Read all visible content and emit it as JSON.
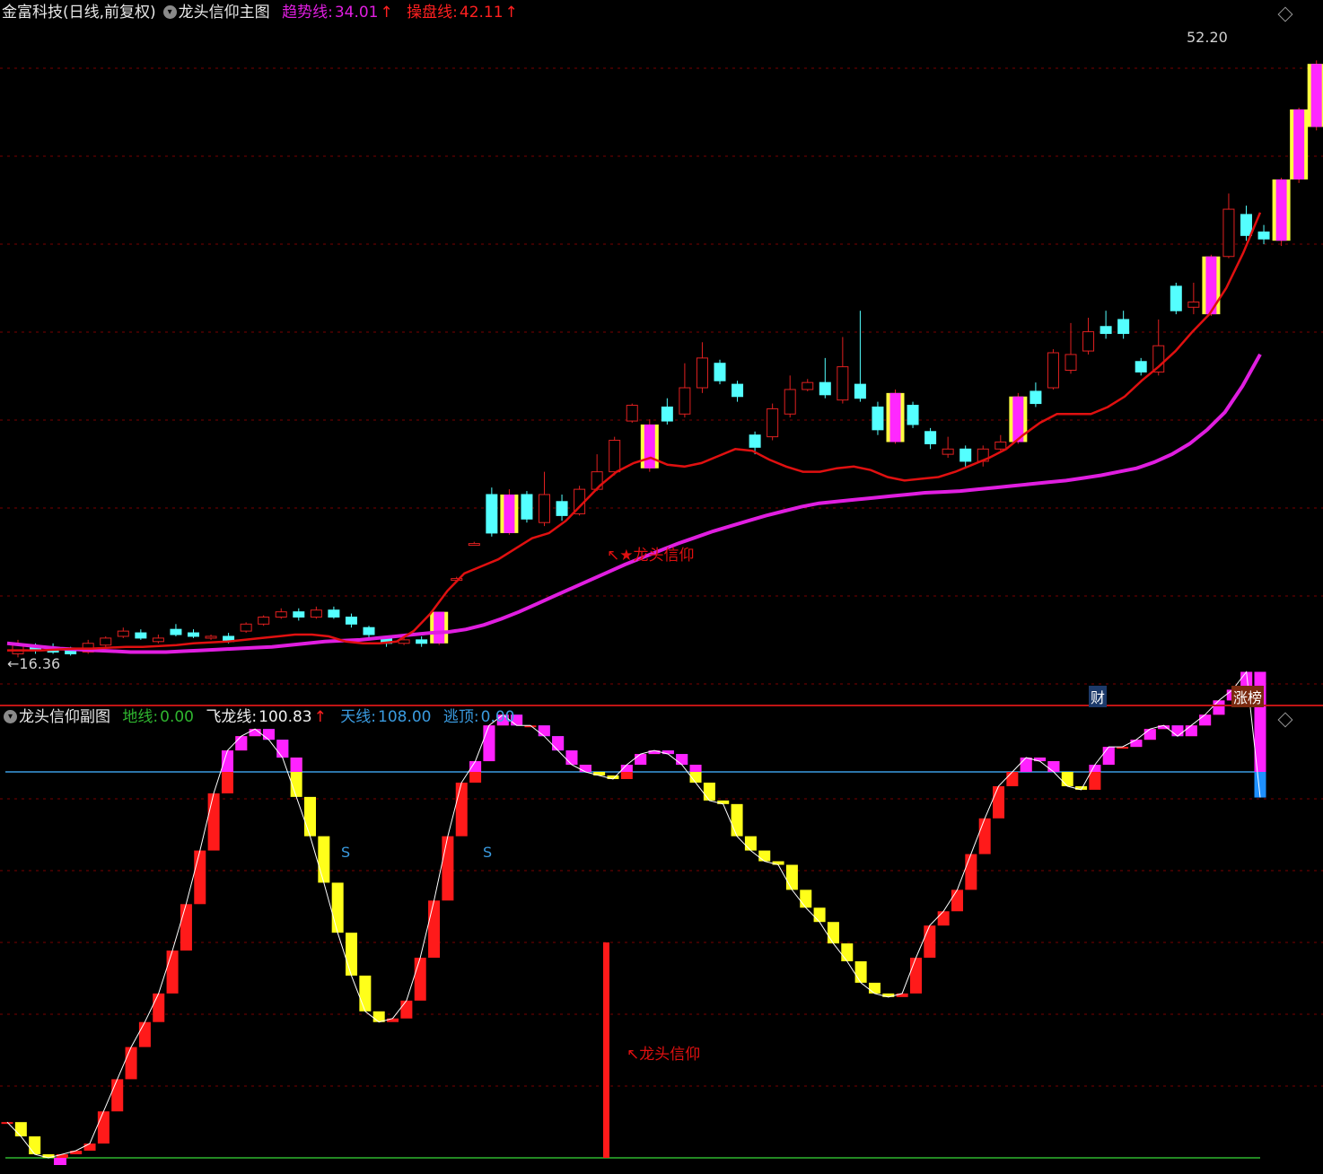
{
  "header": {
    "stock_name": "金富科技(日线,前复权)",
    "main_indicator": "龙头信仰主图",
    "trend_label": "趋势线:",
    "trend_value": "34.01",
    "operate_label": "操盘线:",
    "operate_value": "42.11",
    "up_arrow": "↑"
  },
  "sub_header": {
    "sub_indicator": "龙头信仰副图",
    "ground_label": "地线:",
    "ground_value": "0.00",
    "flydragon_label": "飞龙线:",
    "flydragon_value": "100.83",
    "sky_label": "天线:",
    "sky_value": "108.00",
    "escape_label": "逃顶:",
    "escape_value": "0.00",
    "up_arrow": "↑"
  },
  "annotations": {
    "high_price": "52.20",
    "low_price": "16.36",
    "main_signal": "↖★龙头信仰",
    "sub_signal": "↖龙头信仰",
    "sell_marker": "S",
    "finance_tag": "财",
    "limit_up_tag": "涨榜"
  },
  "colors": {
    "background": "#000000",
    "grid": "#7a0000",
    "trend_line": "#e01ee0",
    "operate_line": "#e01010",
    "up_candle": "#e02020",
    "down_candle": "#54ffff",
    "limit_up_fill": "#ff28ff",
    "limit_up_edge": "#ffff40",
    "bar_red": "#ff1a1a",
    "bar_yellow": "#ffff1a",
    "bar_blue": "#1e90ff",
    "bar_magenta": "#ff22ff",
    "sky_line": "#3a9be0",
    "ground_line": "#2fb52f"
  },
  "chart_data": [
    {
      "type": "candlestick",
      "title": "龙头信仰主图",
      "ylim": [
        15.5,
        53.5
      ],
      "series": [
        {
          "name": "趋势线",
          "values": [
            17.5,
            17.4,
            17.3,
            17.2,
            17.15,
            17.1,
            17.05,
            17.0,
            17.0,
            17.0,
            17.05,
            17.1,
            17.15,
            17.2,
            17.25,
            17.3,
            17.4,
            17.5,
            17.6,
            17.65,
            17.7,
            17.8,
            17.9,
            18.0,
            18.1,
            18.15,
            18.3,
            18.55,
            18.9,
            19.3,
            19.75,
            20.2,
            20.65,
            21.1,
            21.55,
            22.0,
            22.4,
            22.8,
            23.2,
            23.55,
            23.9,
            24.2,
            24.5,
            24.8,
            25.05,
            25.3,
            25.5,
            25.6,
            25.7,
            25.8,
            25.9,
            26.0,
            26.1,
            26.15,
            26.2,
            26.3,
            26.4,
            26.5,
            26.6,
            26.7,
            26.8,
            26.95,
            27.1,
            27.3,
            27.5,
            27.85,
            28.3,
            28.9,
            29.7,
            30.7,
            32.2,
            34.01
          ]
        },
        {
          "name": "操盘线",
          "values": [
            17.1,
            17.1,
            17.1,
            17.15,
            17.2,
            17.2,
            17.25,
            17.3,
            17.3,
            17.35,
            17.4,
            17.5,
            17.55,
            17.6,
            17.7,
            17.8,
            17.9,
            18.0,
            18.0,
            17.9,
            17.6,
            17.5,
            17.5,
            17.6,
            18.2,
            19.2,
            20.5,
            21.5,
            21.9,
            22.3,
            22.9,
            23.5,
            23.8,
            24.5,
            25.5,
            26.5,
            27.3,
            27.8,
            28.1,
            27.7,
            27.6,
            27.8,
            28.2,
            28.6,
            28.5,
            28.0,
            27.6,
            27.3,
            27.3,
            27.5,
            27.6,
            27.4,
            27.0,
            26.8,
            26.9,
            27.0,
            27.3,
            27.7,
            28.1,
            28.6,
            29.4,
            30.1,
            30.6,
            30.6,
            30.6,
            31.0,
            31.6,
            32.5,
            33.3,
            34.2,
            35.3,
            36.3,
            37.8,
            39.8,
            42.11
          ]
        }
      ]
    },
    {
      "type": "bar",
      "title": "龙头信仰副图",
      "ylim": [
        0,
        118
      ],
      "series": [
        {
          "name": "飞龙线",
          "values": [
            10,
            6,
            1,
            0,
            1,
            2,
            4,
            13,
            22,
            31,
            38,
            46,
            58,
            71,
            86,
            102,
            114,
            118,
            120,
            117,
            112,
            101,
            90,
            77,
            63,
            51,
            41,
            38,
            39,
            44,
            56,
            72,
            90,
            105,
            111,
            121,
            124,
            121,
            121,
            118,
            114,
            110,
            108,
            107,
            106,
            110,
            113,
            114,
            113,
            110,
            105,
            100,
            99,
            90,
            86,
            83,
            82,
            75,
            70,
            66,
            60,
            55,
            49,
            46,
            45,
            46,
            56,
            65,
            69,
            75,
            85,
            95,
            104,
            108,
            112,
            111,
            108,
            104,
            103,
            110,
            115,
            115,
            117,
            120,
            121,
            118,
            121,
            124,
            128,
            131,
            136,
            100.83
          ]
        }
      ]
    }
  ]
}
